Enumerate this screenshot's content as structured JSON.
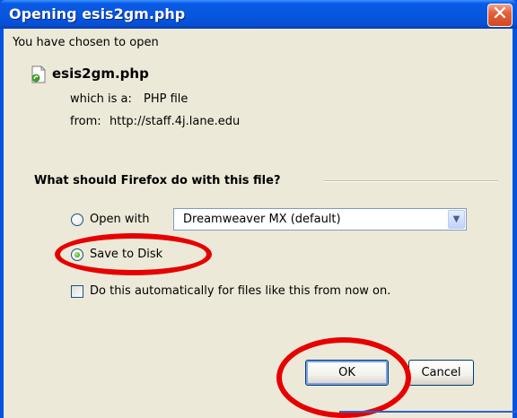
{
  "window": {
    "title": "Opening esis2gm.php",
    "close_glyph": "✕"
  },
  "intro_text": "You have chosen to open",
  "file": {
    "icon": "php-file-icon",
    "name": "esis2gm.php",
    "type_label": "which is a:",
    "type_value": "PHP file",
    "from_label": "from:",
    "from_value": "http://staff.4j.lane.edu"
  },
  "action_group": {
    "title": "What should Firefox do with this file?",
    "open_with_label": "Open with",
    "open_with_selected": "Dreamweaver MX (default)",
    "open_with_checked": false,
    "save_label": "Save to Disk",
    "save_checked": true
  },
  "auto_checkbox": {
    "label": "Do this automatically for files like this from now on.",
    "checked": false
  },
  "buttons": {
    "ok": "OK",
    "cancel": "Cancel"
  },
  "colors": {
    "titlebar": "#0757de",
    "dialog_bg": "#ece9d8",
    "annotation_red": "#e60000"
  }
}
